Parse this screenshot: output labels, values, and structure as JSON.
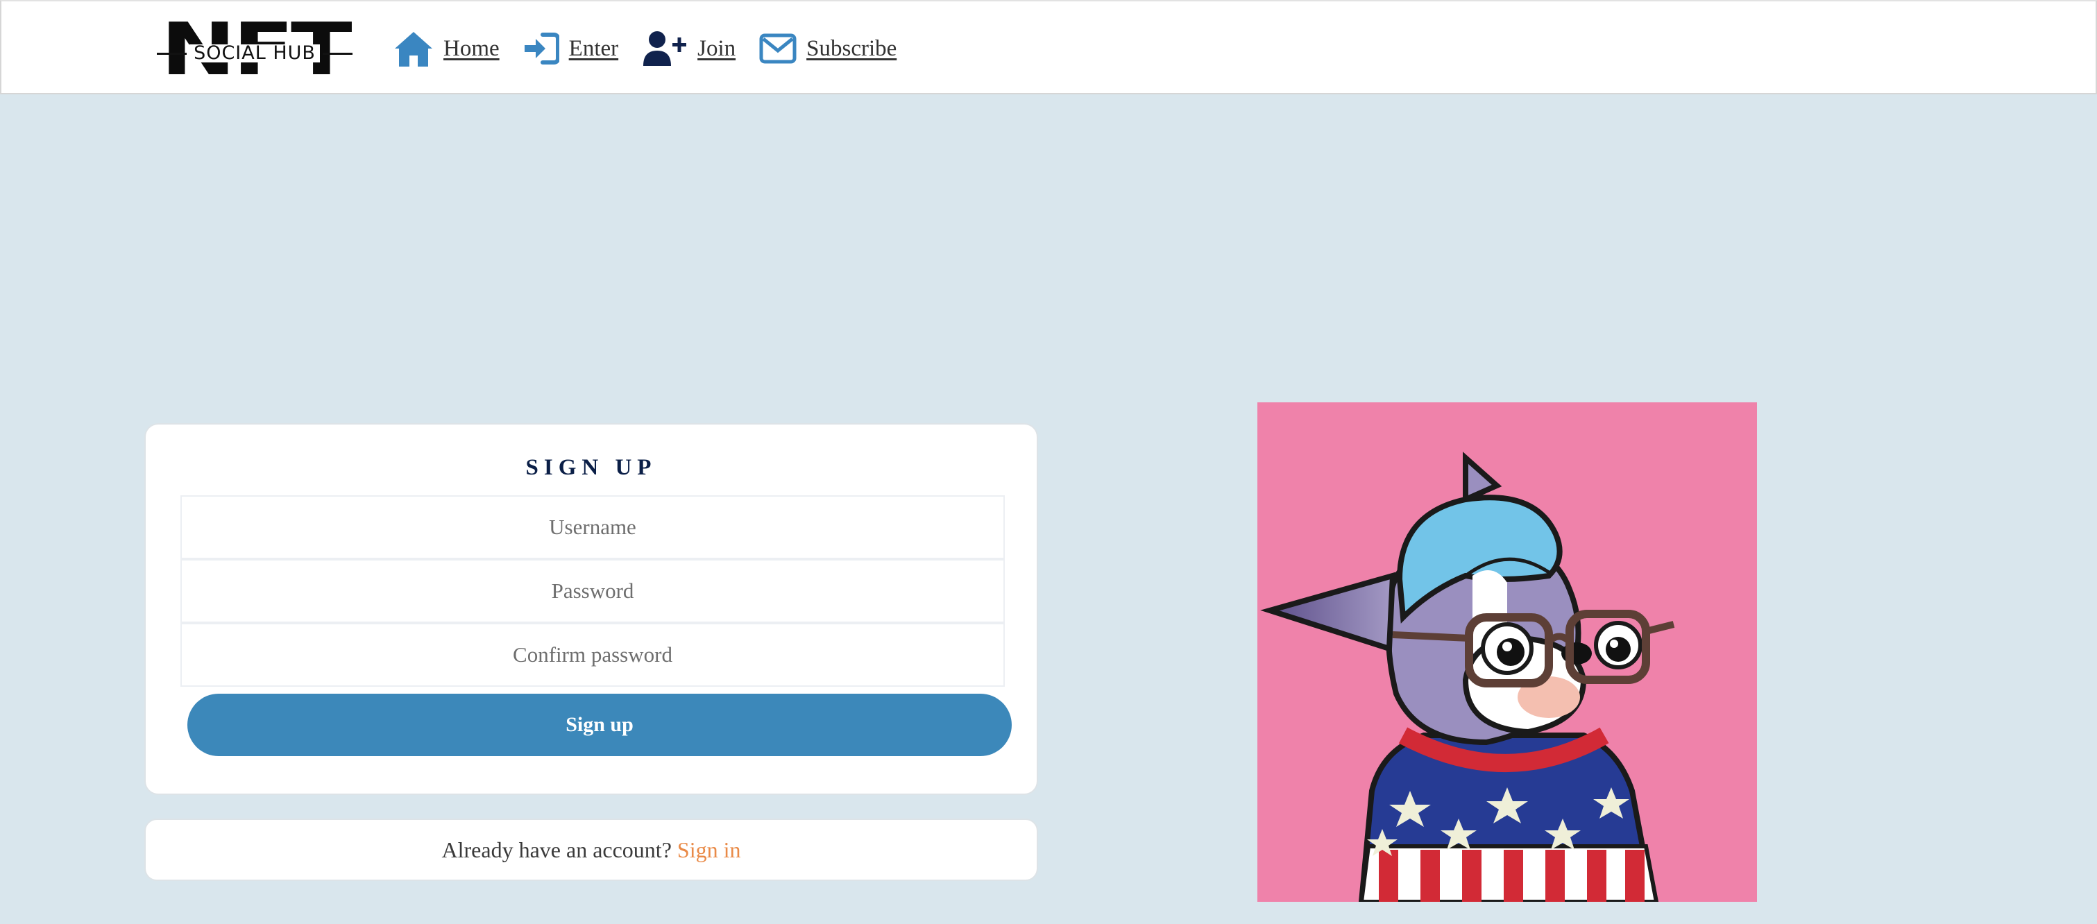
{
  "logo": {
    "letters": "NFT",
    "subtitle": "SOCIAL HUB"
  },
  "nav": [
    {
      "label": "Home",
      "icon": "home-icon"
    },
    {
      "label": "Enter",
      "icon": "sign-in-icon"
    },
    {
      "label": "Join",
      "icon": "user-plus-icon"
    },
    {
      "label": "Subscribe",
      "icon": "envelope-icon"
    }
  ],
  "signup": {
    "title": "SIGN UP",
    "username_placeholder": "Username",
    "password_placeholder": "Password",
    "confirm_placeholder": "Confirm password",
    "button_label": "Sign up"
  },
  "signin_prompt": {
    "text": "Already have an account?",
    "link": "Sign in"
  },
  "colors": {
    "page_bg": "#d9e6ed",
    "accent": "#3c88ba",
    "link_orange": "#e98a47",
    "title_navy": "#0b1f47",
    "art_bg": "#ef82aa"
  }
}
